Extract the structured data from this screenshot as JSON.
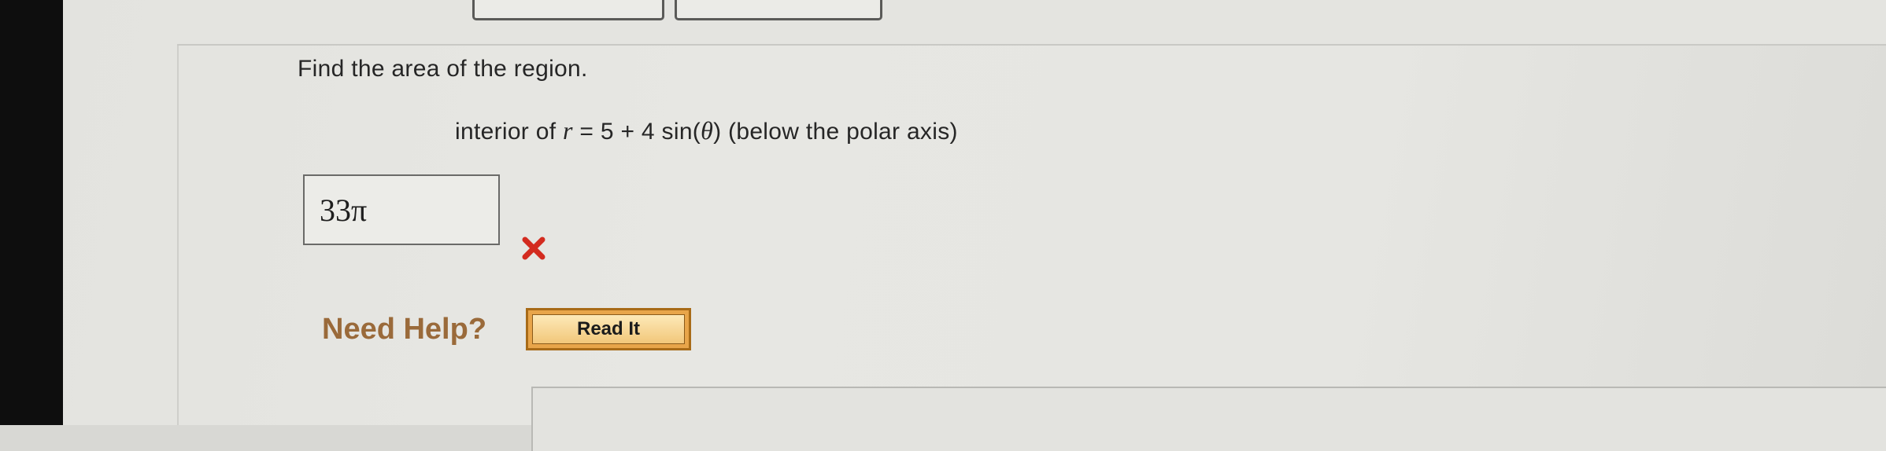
{
  "question": {
    "prompt": "Find the area of the region.",
    "equation_prefix": "interior of ",
    "equation_var": "r",
    "equation_rest": " = 5 + 4 sin(",
    "equation_theta": "θ",
    "equation_suffix": ") (below the polar axis)"
  },
  "answer": {
    "value": "33π",
    "status_icon": "x-mark-icon",
    "status_color": "#d32b1f"
  },
  "help": {
    "label": "Need Help?",
    "read_it_label": "Read It"
  }
}
